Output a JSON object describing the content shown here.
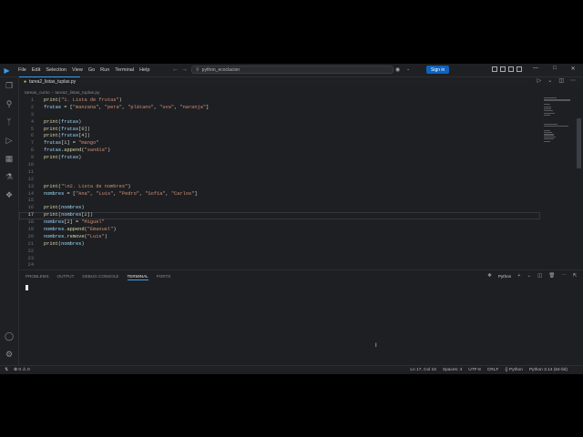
{
  "titlebar": {
    "menu": [
      "File",
      "Edit",
      "Selection",
      "View",
      "Go",
      "Run",
      "Terminal",
      "Help"
    ],
    "search_text": "python_ecoclacion",
    "signin_label": "Sign in"
  },
  "editor": {
    "tab_label": "tarea2_listas_tuplas.py",
    "breadcrumb": [
      "tareas_curso",
      "tarea2_listas_tuplas.py"
    ],
    "current_line": 17
  },
  "code_lines": [
    "print(\"1. Lista de frutas\")",
    "frutas = [\"manzana\", \"pera\", \"plátano\", \"uva\", \"naranja\"]",
    "",
    "print(frutas)",
    "print(frutas[0])",
    "print(frutas[4])",
    "frutas[1] = \"mango\"",
    "frutas.append(\"sandía\")",
    "print(frutas)",
    "",
    "",
    "",
    "print(\"\\n2. Lista de nombres\")",
    "nombres = [\"Ana\", \"Luis\", \"Pedro\", \"Sofía\", \"Carlos\"]",
    "",
    "print(nombres)",
    "print(nombres[2])",
    "nombres[2] = \"Miguel\"",
    "nombres.append(\"Emanuel\")",
    "nombres.remove(\"Luis\")",
    "print(nombres)",
    "",
    "",
    ""
  ],
  "panel": {
    "tabs": [
      "PROBLEMS",
      "OUTPUT",
      "DEBUG CONSOLE",
      "TERMINAL",
      "PORTS"
    ],
    "active_tab": "TERMINAL",
    "terminal_label": "Python"
  },
  "statusbar": {
    "errors": "0",
    "warnings": "0",
    "position": "Ln 17, Col 16",
    "spaces": "Spaces: 4",
    "encoding": "UTF-8",
    "eol": "CRLF",
    "language": "Python",
    "interpreter": "Python 3.14 (64-bit)"
  },
  "colors": {
    "background": "#1e1f22",
    "accent": "#3c9cf0",
    "signin_button": "#0e63be"
  }
}
